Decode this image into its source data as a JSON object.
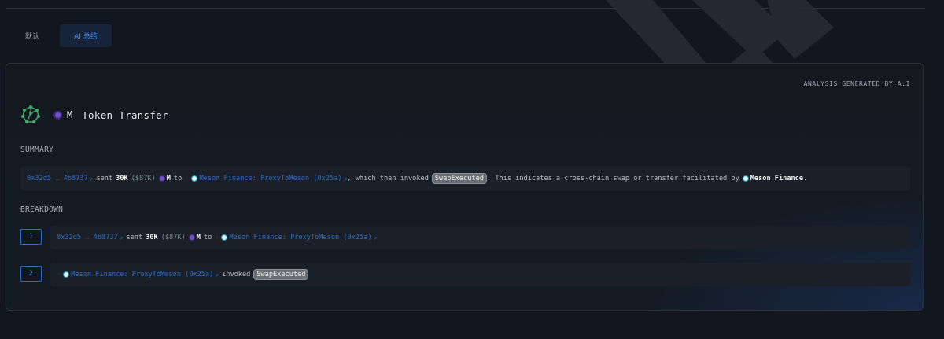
{
  "tabs": [
    {
      "label": "默认",
      "active": false
    },
    {
      "label": "AI 总结",
      "active": true
    }
  ],
  "panel": {
    "generated_label": "ANALYSIS GENERATED BY A.I",
    "title_symbol": "M",
    "title": "Token Transfer"
  },
  "summary": {
    "heading": "SUMMARY",
    "from_addr_start": "0x32d5",
    "from_addr_end": "4b8737",
    "verb_sent": "sent",
    "amount": "30K",
    "amount_usd": "($87K)",
    "token": "M",
    "to_word": "to",
    "to_entity": "Meson Finance: ProxyToMeson (0x25a)",
    "mid_text": ", which then invoked",
    "event": "SwapExecuted",
    "tail_text": ". This indicates a cross-chain swap or transfer facilitated by",
    "protocol": "Meson Finance",
    "end_text": "."
  },
  "breakdown": {
    "heading": "BREAKDOWN",
    "steps": [
      {
        "num": "1",
        "from_addr_start": "0x32d5",
        "from_addr_end": "4b8737",
        "verb_sent": "sent",
        "amount": "30K",
        "amount_usd": "($87K)",
        "token": "M",
        "to_word": "to",
        "to_entity": "Meson Finance: ProxyToMeson (0x25a)"
      },
      {
        "num": "2",
        "entity": "Meson Finance: ProxyToMeson (0x25a)",
        "verb_invoked": "invoked",
        "event": "SwapExecuted"
      }
    ]
  },
  "colors": {
    "background": "#12161e",
    "accent": "#2f6fc4",
    "panel_border": "#2a313b",
    "token": "#6d4fc7"
  }
}
